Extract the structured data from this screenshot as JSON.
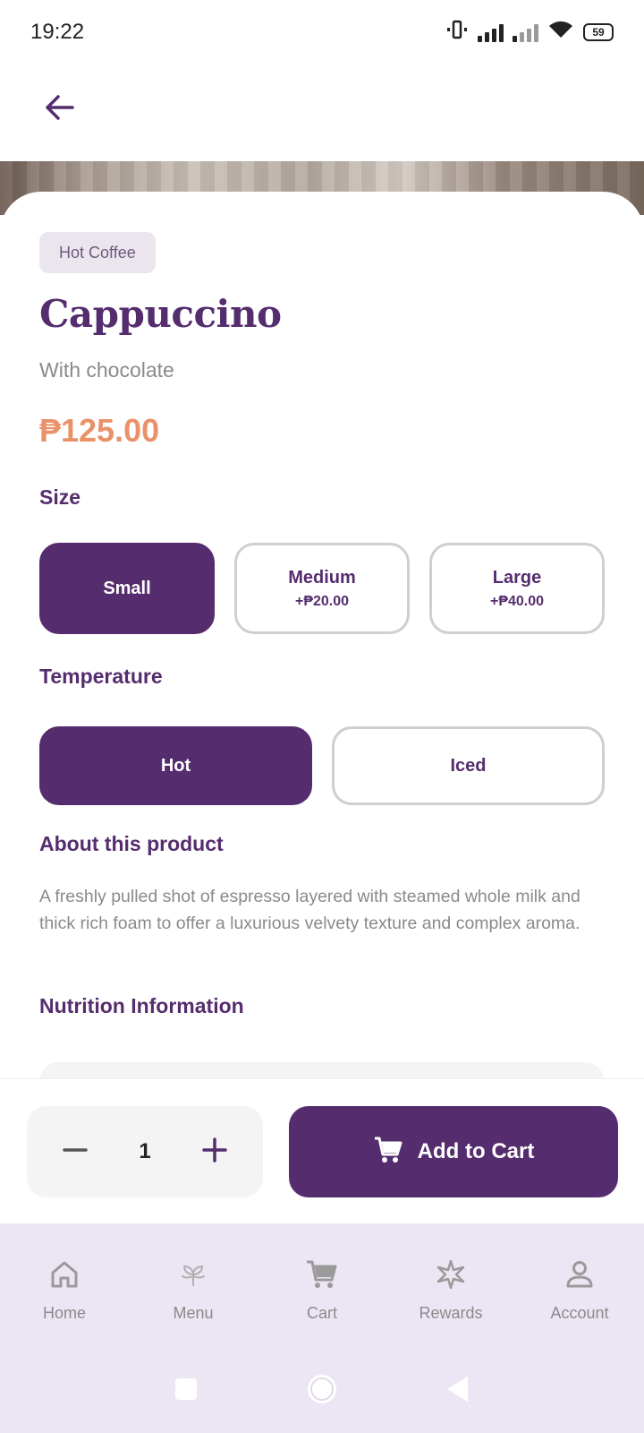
{
  "status_bar": {
    "time": "19:22",
    "battery": "59",
    "icons": [
      "vibrate-icon",
      "signal-icon",
      "signal-weak-icon",
      "wifi-icon",
      "battery-icon"
    ]
  },
  "top_bar": {
    "back_icon": "arrow-left-icon"
  },
  "product": {
    "category": "Hot Coffee",
    "name": "Cappuccino",
    "subtitle": "With chocolate",
    "price": "₱125.00"
  },
  "size": {
    "label": "Size",
    "options": [
      {
        "name": "Small",
        "extra": "",
        "selected": true
      },
      {
        "name": "Medium",
        "extra": "+₱20.00",
        "selected": false
      },
      {
        "name": "Large",
        "extra": "+₱40.00",
        "selected": false
      }
    ]
  },
  "temperature": {
    "label": "Temperature",
    "options": [
      {
        "name": "Hot",
        "selected": true
      },
      {
        "name": "Iced",
        "selected": false
      }
    ]
  },
  "about": {
    "label": "About this product",
    "text": "A freshly pulled shot of espresso layered with steamed whole milk and thick rich foam to offer a luxurious velvety texture and complex aroma."
  },
  "nutrition": {
    "label": "Nutrition Information"
  },
  "cart_bar": {
    "quantity": "1",
    "add_label": "Add to Cart",
    "icons": [
      "minus-icon",
      "plus-icon",
      "cart-icon"
    ]
  },
  "bottom_nav": {
    "items": [
      {
        "label": "Home",
        "icon": "home-icon"
      },
      {
        "label": "Menu",
        "icon": "leaf-icon"
      },
      {
        "label": "Cart",
        "icon": "cart-icon"
      },
      {
        "label": "Rewards",
        "icon": "sparkle-icon"
      },
      {
        "label": "Account",
        "icon": "person-icon"
      }
    ]
  },
  "colors": {
    "primary": "#552d6e",
    "price": "#e9926a",
    "chip_bg": "#ebe6ee",
    "nav_bg": "#ece6f4"
  }
}
